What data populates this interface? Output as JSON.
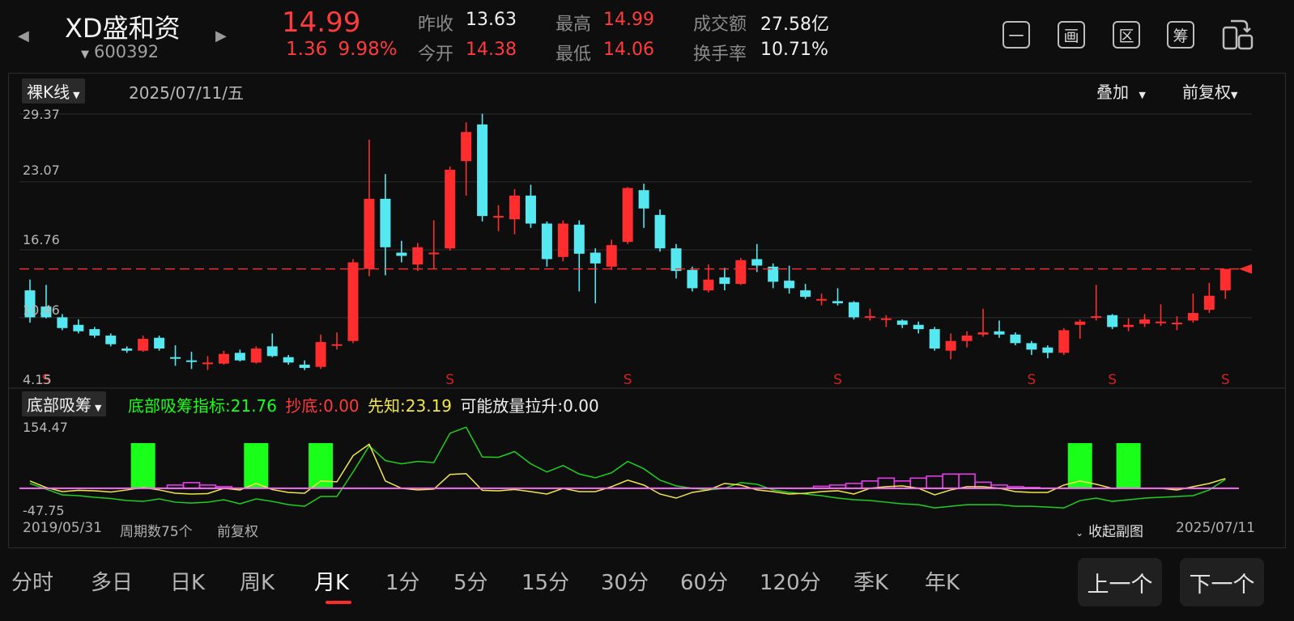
{
  "header": {
    "name": "XD盛和资",
    "code": "600392",
    "price": "14.99",
    "change": "1.36",
    "change_pct": "9.98%",
    "prev_close_label": "昨收",
    "prev_close": "13.63",
    "open_label": "今开",
    "open": "14.38",
    "high_label": "最高",
    "high": "14.99",
    "low_label": "最低",
    "low": "14.06",
    "amount_label": "成交额",
    "amount": "27.58亿",
    "turnover_label": "换手率",
    "turnover": "10.71%"
  },
  "toolbar": {
    "btn1": "一",
    "btn2": "画",
    "btn3": "区",
    "btn4": "筹"
  },
  "kpanel": {
    "type_label": "裸K线",
    "date": "2025/07/11/五",
    "overlay_label": "叠加",
    "adjust_label": "前复权",
    "y_ticks": [
      "29.37",
      "23.07",
      "16.76",
      "10.46",
      "4.15"
    ],
    "signal_label": "S"
  },
  "subpanel": {
    "indicator_label": "底部吸筹",
    "ind_main_label": "底部吸筹指标:",
    "ind_main_value": "21.76",
    "ind_bottom_label": "抄底:",
    "ind_bottom_value": "0.00",
    "ind_foresight_label": "先知:",
    "ind_foresight_value": "23.19",
    "ind_volume_label": "可能放量拉升:",
    "ind_volume_value": "0.00",
    "y_top": "154.47",
    "y_bottom": "-47.75",
    "start_date": "2019/05/31",
    "period_count": "周期数75个",
    "adjust": "前复权",
    "collapse_label": "收起副图",
    "end_date": "2025/07/11"
  },
  "periods": [
    "分时",
    "多日",
    "日K",
    "周K",
    "月K",
    "1分",
    "5分",
    "15分",
    "30分",
    "60分",
    "120分",
    "季K",
    "年K"
  ],
  "active_period": "月K",
  "buttons": {
    "prev": "上一个",
    "next": "下一个"
  },
  "colors": {
    "up": "#ff2d2d",
    "down": "#55e8f0",
    "green": "#19ff19",
    "yellow": "#f2e64a",
    "magenta": "#e43be8"
  },
  "chart_data": [
    {
      "type": "candlestick",
      "ylim": [
        4.15,
        29.37
      ],
      "current_price": 14.99,
      "candles": [
        [
          13.0,
          10.5,
          14.0,
          10.0
        ],
        [
          11.5,
          10.5,
          13.5,
          10.4
        ],
        [
          10.5,
          9.5,
          10.8,
          9.3
        ],
        [
          9.8,
          9.2,
          10.3,
          9.0
        ],
        [
          9.4,
          8.8,
          9.6,
          8.6
        ],
        [
          8.8,
          8.0,
          9.0,
          7.8
        ],
        [
          7.6,
          7.4,
          7.8,
          7.2
        ],
        [
          7.4,
          8.5,
          8.8,
          7.3
        ],
        [
          8.6,
          7.6,
          8.8,
          7.4
        ],
        [
          6.8,
          6.7,
          7.9,
          6.0
        ],
        [
          6.5,
          6.4,
          7.3,
          5.7
        ],
        [
          6.3,
          6.3,
          6.9,
          5.6
        ],
        [
          6.2,
          7.1,
          7.4,
          6.1
        ],
        [
          7.2,
          6.5,
          7.5,
          6.4
        ],
        [
          6.3,
          7.6,
          7.8,
          6.2
        ],
        [
          7.8,
          6.9,
          9.0,
          6.8
        ],
        [
          6.8,
          6.3,
          7.0,
          6.1
        ],
        [
          6.1,
          5.8,
          6.5,
          5.6
        ],
        [
          5.9,
          8.2,
          8.9,
          5.7
        ],
        [
          7.9,
          8.0,
          9.1,
          7.5
        ],
        [
          8.3,
          15.6,
          15.9,
          8.1
        ],
        [
          15.0,
          21.5,
          27.0,
          14.3
        ],
        [
          21.5,
          17.0,
          23.8,
          14.4
        ],
        [
          16.5,
          16.2,
          17.6,
          15.6
        ],
        [
          15.4,
          17.0,
          17.4,
          14.8
        ],
        [
          16.4,
          16.5,
          19.5,
          15.0
        ],
        [
          16.9,
          24.2,
          24.5,
          16.7
        ],
        [
          25.0,
          27.7,
          28.6,
          21.8
        ],
        [
          28.4,
          19.9,
          29.4,
          19.4
        ],
        [
          19.9,
          19.9,
          20.9,
          18.5
        ],
        [
          19.6,
          21.8,
          22.4,
          18.2
        ],
        [
          21.8,
          19.2,
          22.8,
          18.8
        ],
        [
          19.2,
          15.9,
          19.4,
          15.2
        ],
        [
          16.1,
          19.2,
          19.5,
          15.7
        ],
        [
          19.1,
          16.4,
          19.5,
          12.9
        ],
        [
          16.5,
          15.5,
          16.9,
          11.8
        ],
        [
          15.2,
          17.2,
          17.7,
          14.9
        ],
        [
          17.5,
          22.5,
          22.6,
          17.3
        ],
        [
          22.3,
          20.6,
          22.9,
          18.8
        ],
        [
          20.0,
          16.9,
          20.5,
          16.6
        ],
        [
          16.9,
          14.8,
          17.3,
          14.1
        ],
        [
          14.9,
          13.2,
          15.2,
          12.9
        ],
        [
          13.0,
          14.0,
          15.4,
          12.8
        ],
        [
          14.2,
          13.6,
          15.1,
          13.0
        ],
        [
          13.6,
          15.8,
          16.0,
          13.5
        ],
        [
          15.9,
          15.3,
          17.3,
          14.7
        ],
        [
          15.2,
          13.8,
          15.5,
          13.2
        ],
        [
          13.9,
          13.2,
          15.3,
          12.7
        ],
        [
          13.0,
          12.4,
          13.6,
          12.2
        ],
        [
          12.2,
          12.2,
          12.7,
          11.6
        ],
        [
          12.0,
          11.8,
          13.2,
          11.6
        ],
        [
          11.9,
          10.5,
          12.0,
          10.3
        ],
        [
          10.6,
          10.6,
          11.3,
          10.2
        ],
        [
          10.4,
          10.4,
          10.7,
          9.6
        ],
        [
          10.2,
          9.8,
          10.3,
          9.5
        ],
        [
          9.8,
          9.4,
          10.1,
          9.0
        ],
        [
          9.4,
          7.6,
          9.6,
          7.4
        ],
        [
          7.4,
          8.3,
          9.0,
          6.6
        ],
        [
          8.3,
          8.8,
          9.2,
          7.7
        ],
        [
          8.9,
          9.1,
          11.3,
          8.7
        ],
        [
          9.2,
          8.9,
          10.2,
          8.6
        ],
        [
          8.9,
          8.1,
          9.1,
          7.9
        ],
        [
          8.1,
          7.5,
          8.3,
          7.0
        ],
        [
          7.7,
          7.2,
          7.9,
          6.7
        ],
        [
          7.2,
          9.3,
          9.5,
          7.0
        ],
        [
          9.8,
          10.1,
          10.3,
          8.5
        ],
        [
          10.6,
          10.6,
          13.5,
          10.2
        ],
        [
          10.7,
          9.6,
          10.8,
          9.4
        ],
        [
          9.6,
          9.8,
          10.4,
          9.2
        ],
        [
          9.9,
          10.3,
          10.8,
          9.6
        ],
        [
          10.1,
          10.1,
          11.7,
          9.7
        ],
        [
          10.0,
          10.0,
          10.6,
          9.3
        ],
        [
          10.2,
          10.9,
          12.7,
          10.0
        ],
        [
          11.2,
          12.5,
          13.7,
          10.9
        ],
        [
          13.0,
          14.99,
          14.99,
          12.2
        ]
      ],
      "signals_at": [
        1,
        26,
        37,
        50,
        62,
        67,
        74
      ]
    },
    {
      "type": "indicator",
      "ylim": [
        -47.75,
        154.47
      ],
      "green_bars_at": [
        7,
        14,
        18,
        65,
        68
      ],
      "magenta_bars": [
        [
          9,
          8
        ],
        [
          10,
          14
        ],
        [
          11,
          8
        ],
        [
          12,
          4
        ],
        [
          49,
          5
        ],
        [
          50,
          8
        ],
        [
          51,
          12
        ],
        [
          52,
          18
        ],
        [
          53,
          25
        ],
        [
          54,
          18
        ],
        [
          55,
          25
        ],
        [
          56,
          30
        ],
        [
          57,
          35
        ],
        [
          58,
          35
        ],
        [
          59,
          15
        ],
        [
          60,
          8
        ],
        [
          61,
          4
        ],
        [
          62,
          2
        ]
      ],
      "yellow": [
        18,
        2,
        -8,
        -5,
        -6,
        -9,
        -4,
        2,
        -4,
        -12,
        -14,
        -13,
        0,
        -4,
        12,
        -3,
        -10,
        -12,
        18,
        16,
        80,
        108,
        18,
        0,
        -4,
        -2,
        34,
        36,
        -5,
        -6,
        -3,
        -8,
        -14,
        0,
        -8,
        -8,
        4,
        20,
        8,
        -14,
        -24,
        -10,
        -4,
        12,
        8,
        -4,
        -8,
        -14,
        -12,
        -8,
        -6,
        -14,
        0,
        4,
        6,
        0,
        -16,
        -4,
        4,
        4,
        0,
        -8,
        -10,
        -10,
        8,
        18,
        10,
        0,
        0,
        0,
        0,
        -4,
        4,
        12,
        24
      ],
      "green": [
        12,
        -2,
        -16,
        -18,
        -22,
        -25,
        -30,
        -32,
        -26,
        -34,
        -36,
        -34,
        -28,
        -38,
        -26,
        -32,
        -40,
        -44,
        -20,
        -20,
        40,
        104,
        68,
        60,
        66,
        63,
        135,
        150,
        77,
        76,
        90,
        60,
        40,
        56,
        35,
        26,
        38,
        66,
        48,
        20,
        6,
        0,
        -4,
        0,
        14,
        10,
        -4,
        -10,
        -14,
        -18,
        -24,
        -28,
        -30,
        -34,
        -38,
        -40,
        -48,
        -44,
        -40,
        -40,
        -40,
        -44,
        -44,
        -46,
        -48,
        -30,
        -24,
        -32,
        -28,
        -24,
        -22,
        -20,
        -18,
        -4,
        22
      ]
    }
  ]
}
